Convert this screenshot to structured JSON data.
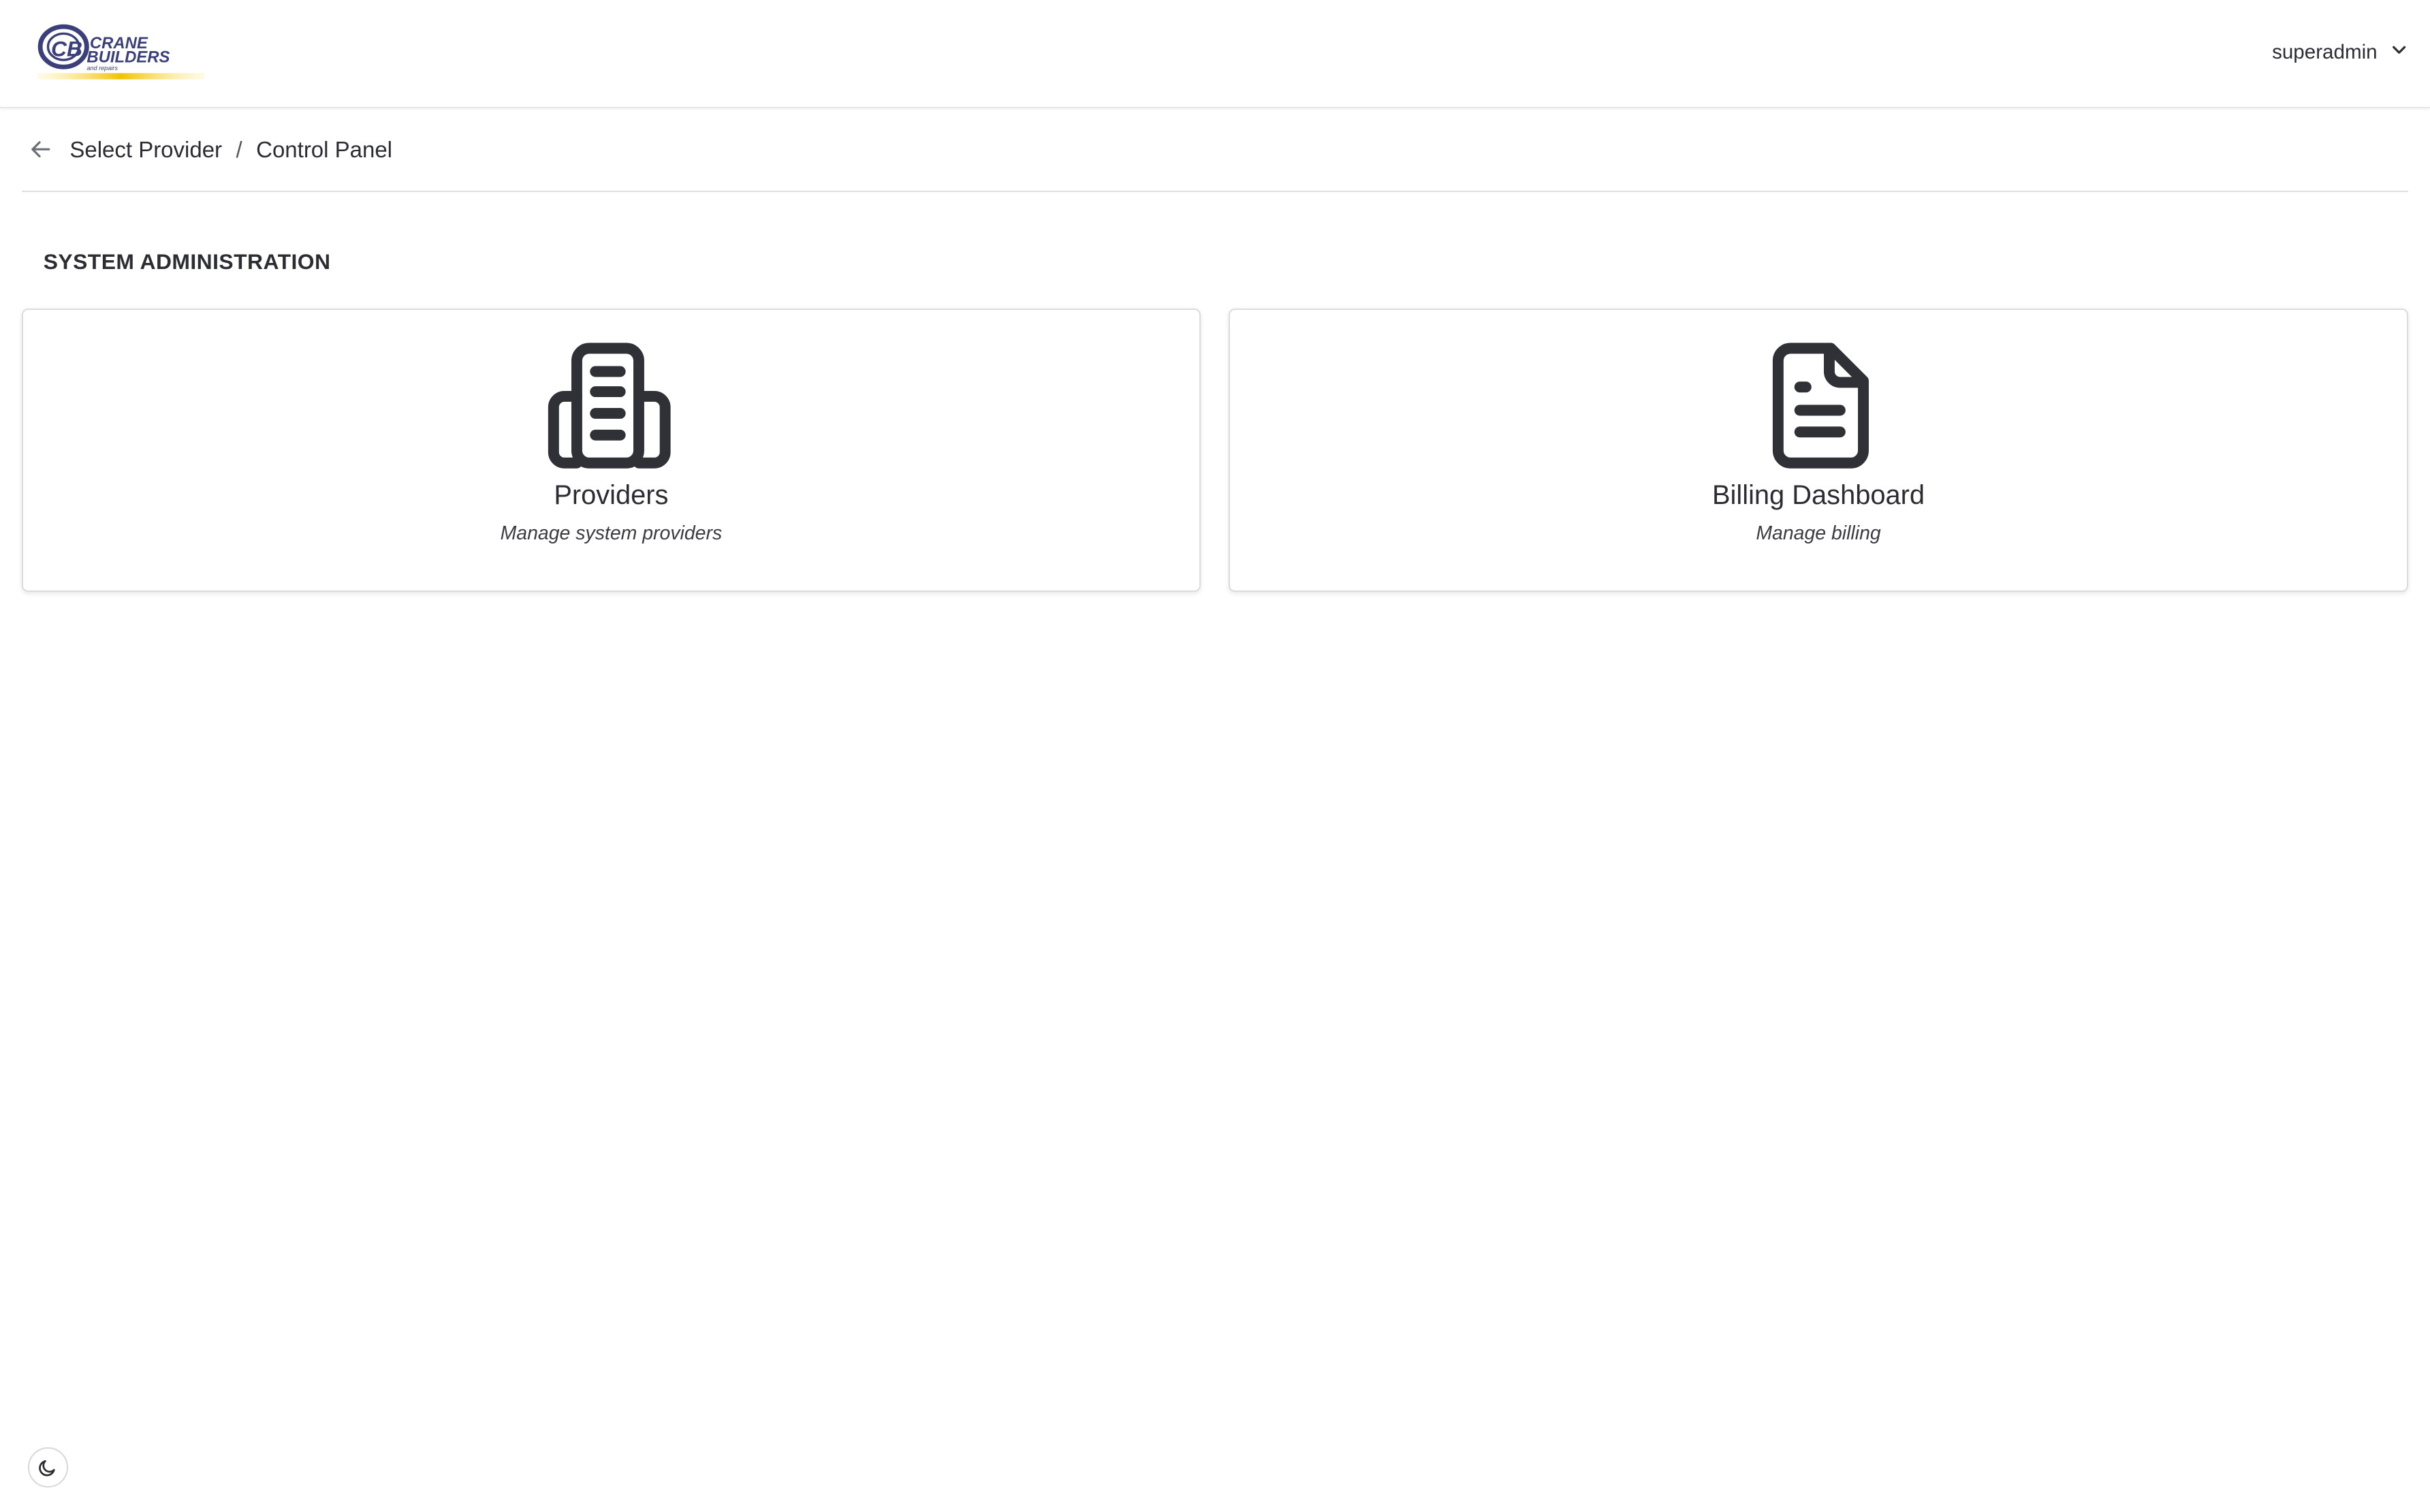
{
  "header": {
    "logo": {
      "name": "crane-builders-logo",
      "text_line1": "CRANE",
      "text_line2": "BUILDERS",
      "text_line3": "and repairs",
      "accent": "#f2c200",
      "brand_color": "#3b3f7a"
    },
    "user_menu": {
      "username": "superadmin",
      "icon": "chevron-down-icon"
    }
  },
  "breadcrumb": {
    "back_icon": "arrow-left-icon",
    "items": [
      "Select Provider",
      "Control Panel"
    ],
    "separator": "/"
  },
  "section": {
    "title": "SYSTEM ADMINISTRATION"
  },
  "cards": [
    {
      "icon": "building-icon",
      "title": "Providers",
      "description": "Manage system providers"
    },
    {
      "icon": "document-icon",
      "title": "Billing Dashboard",
      "description": "Manage billing"
    }
  ],
  "footer": {
    "theme_toggle_icon": "moon-icon"
  },
  "colors": {
    "icon": "#2f3136",
    "border": "#dadce0",
    "text": "#2b2d33"
  }
}
